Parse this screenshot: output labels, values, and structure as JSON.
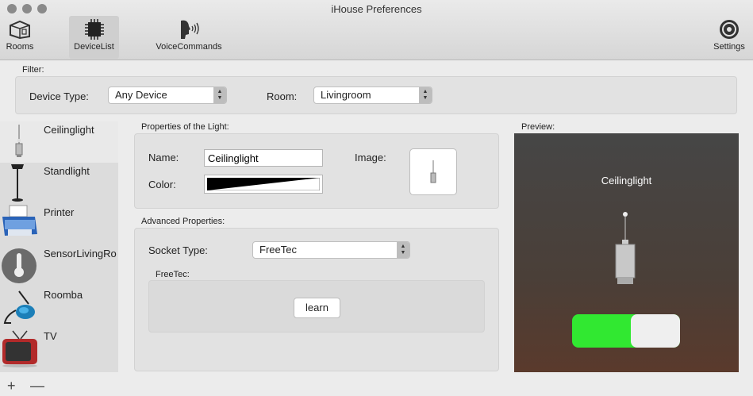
{
  "window": {
    "title": "iHouse Preferences"
  },
  "toolbar": {
    "items": [
      {
        "label": "Rooms",
        "icon": "rooms-icon"
      },
      {
        "label": "DeviceList",
        "icon": "chip-icon",
        "selected": true
      },
      {
        "label": "VoiceCommands",
        "icon": "voice-icon"
      },
      {
        "label": "Settings",
        "icon": "gear-icon"
      }
    ]
  },
  "filter": {
    "label": "Filter:",
    "device_type_label": "Device Type:",
    "device_type_value": "Any Device",
    "room_label": "Room:",
    "room_value": "Livingroom"
  },
  "devices": [
    {
      "name": "Ceilinglight",
      "icon": "ceiling-lamp-icon",
      "selected": true
    },
    {
      "name": "Standlight",
      "icon": "floor-lamp-icon"
    },
    {
      "name": "Printer",
      "icon": "printer-icon"
    },
    {
      "name": "SensorLivingRo",
      "icon": "thermometer-icon"
    },
    {
      "name": "Roomba",
      "icon": "vacuum-icon"
    },
    {
      "name": "TV",
      "icon": "tv-icon"
    }
  ],
  "properties": {
    "title": "Properties of the Light:",
    "name_label": "Name:",
    "name_value": "Ceilinglight",
    "image_label": "Image:",
    "color_label": "Color:"
  },
  "advanced": {
    "title": "Advanced Properties:",
    "socket_label": "Socket Type:",
    "socket_value": "FreeTec",
    "group_label": "FreeTec:",
    "learn_button": "learn"
  },
  "preview": {
    "label": "Preview:",
    "device_name": "Ceilinglight",
    "switch_on": true
  },
  "footer": {
    "add": "+",
    "remove": "—"
  },
  "colors": {
    "switch_on": "#31e831",
    "selected_tool": "#cfcfcf"
  }
}
